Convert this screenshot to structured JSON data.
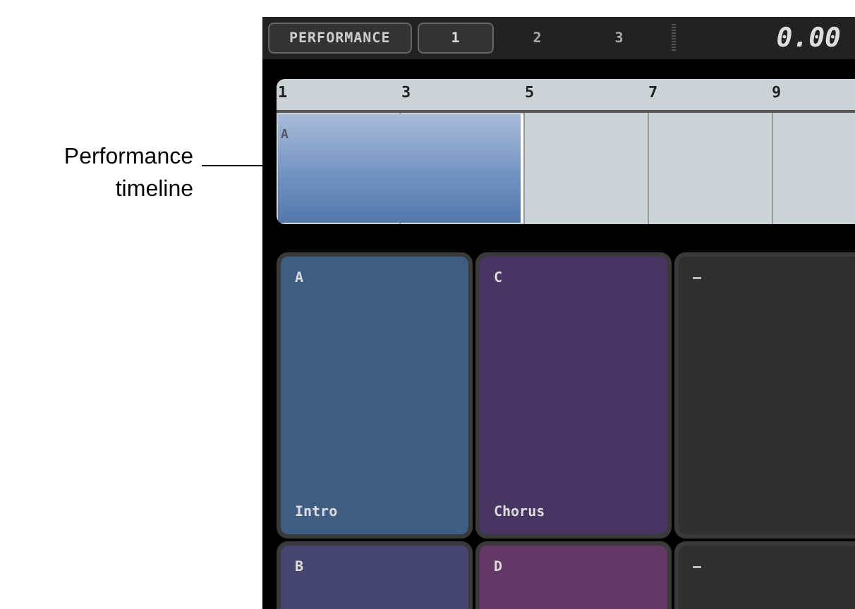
{
  "callout": {
    "text": "Performance timeline"
  },
  "toolbar": {
    "mode_button": "PERFORMANCE",
    "tabs": [
      {
        "label": "1",
        "selected": true
      },
      {
        "label": "2",
        "selected": false
      },
      {
        "label": "3",
        "selected": false
      }
    ],
    "time": "0.00"
  },
  "timeline": {
    "ruler": [
      "1",
      "3",
      "5",
      "7",
      "9"
    ],
    "clips": [
      {
        "label": "A",
        "color": "#6f8fc0"
      }
    ]
  },
  "pads": [
    {
      "label": "A",
      "name": "Intro",
      "color": "#3f5d82"
    },
    {
      "label": "C",
      "name": "Chorus",
      "color": "#473661"
    },
    {
      "label": "–",
      "color": "#303030"
    },
    {
      "label": "B",
      "color": "#45456f"
    },
    {
      "label": "D",
      "color": "#623865"
    },
    {
      "label": "–",
      "color": "#303030"
    }
  ]
}
